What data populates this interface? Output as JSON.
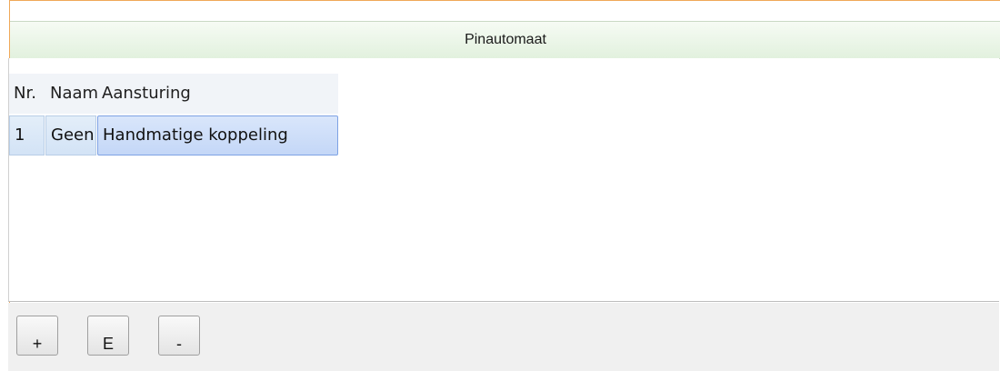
{
  "header": {
    "title": "Pinautomaat"
  },
  "table": {
    "columns": [
      {
        "label": "Nr."
      },
      {
        "label": "Naam"
      },
      {
        "label": "Aansturing"
      }
    ],
    "rows": [
      {
        "nr": "1",
        "naam": "Geen",
        "aansturing": "Handmatige koppeling"
      }
    ]
  },
  "toolbar": {
    "add_label": "+",
    "edit_label": "E",
    "remove_label": "-"
  }
}
